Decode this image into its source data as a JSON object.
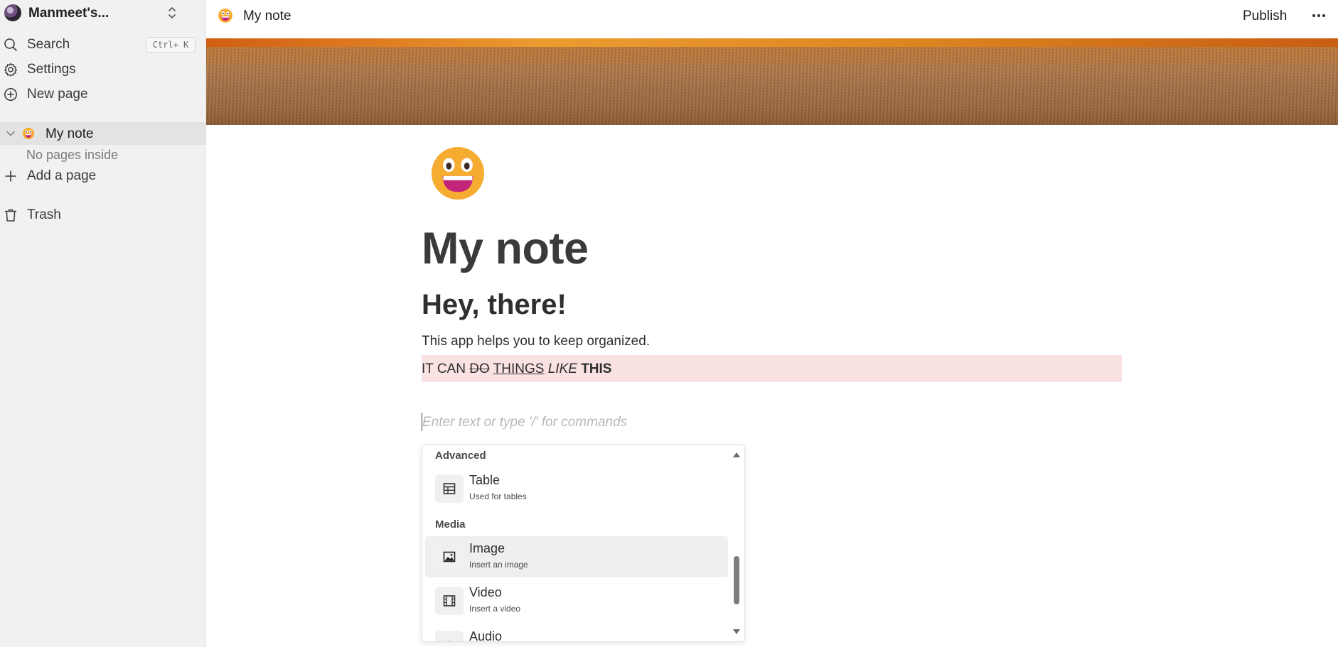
{
  "workspace": {
    "name": "Manmeet's..."
  },
  "sidebar": {
    "search": {
      "label": "Search",
      "shortcut": "Ctrl+ K"
    },
    "settings": {
      "label": "Settings"
    },
    "new_page": {
      "label": "New page"
    },
    "page": {
      "label": "My note",
      "empty_text": "No pages inside"
    },
    "add_page": {
      "label": "Add a page"
    },
    "trash": {
      "label": "Trash"
    }
  },
  "topbar": {
    "title": "My note",
    "publish_label": "Publish"
  },
  "document": {
    "title": "My note",
    "heading": "Hey, there!",
    "paragraph": "This app helps you to keep organized.",
    "styled_line": {
      "part1": "IT CAN ",
      "strike": "DO",
      "space1": " ",
      "underline": "THINGS",
      "space2": " ",
      "italic": "LIKE",
      "space3": " ",
      "bold": "THIS"
    },
    "placeholder": "Enter text or type '/' for commands"
  },
  "command_menu": {
    "groups": [
      {
        "label": "Advanced"
      },
      {
        "label": "Media"
      }
    ],
    "items": [
      {
        "title": "Table",
        "subtitle": "Used for tables",
        "icon": "table-icon"
      },
      {
        "title": "Image",
        "subtitle": "Insert an image",
        "icon": "image-icon",
        "selected": true
      },
      {
        "title": "Video",
        "subtitle": "Insert a video",
        "icon": "video-icon"
      },
      {
        "title": "Audio",
        "subtitle": "",
        "icon": "audio-icon"
      }
    ]
  },
  "colors": {
    "sidebar_bg": "#f1f1f1",
    "highlight_bg": "#f9e2e1",
    "emoji_yellow": "#f6ac30",
    "emoji_mouth": "#c2247a"
  }
}
